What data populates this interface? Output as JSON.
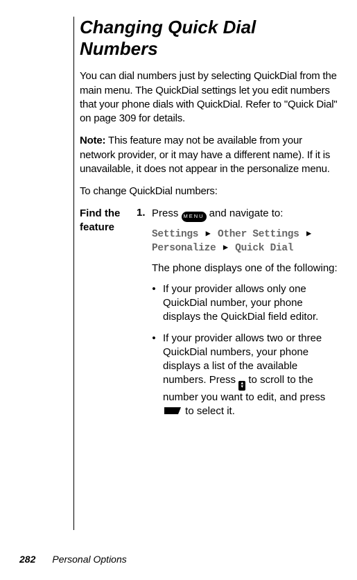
{
  "page": {
    "number": "282",
    "chapter": "Personal Options"
  },
  "heading": "Changing Quick Dial Numbers",
  "intro": "You can dial numbers just by selecting QuickDial from the main menu. The QuickDial settings let you edit numbers that your phone dials with QuickDial. Refer to \"Quick Dial\" on page 309 for details.",
  "note_label": "Note:",
  "note_body": " This feature may not be available from your network provider, or it may have a different name). If it is unavailable, it does not appear in the personalize menu.",
  "lead_in": "To change QuickDial numbers:",
  "left_label_line1": "Find the",
  "left_label_line2": "feature",
  "step1": {
    "num": "1.",
    "prefix": "Press ",
    "menu_key": "MENU",
    "suffix": " and navigate to:"
  },
  "menu_path": {
    "p1": "Settings",
    "p2": "Other Settings",
    "p3": "Personalize",
    "p4": "Quick Dial"
  },
  "after_path": "The phone displays one of the following:",
  "bullets": [
    "If your provider allows only one QuickDial number, your phone displays the QuickDial field editor.",
    {
      "pre": "If your provider allows two or three QuickDial numbers, your phone displays a list of the available numbers. Press ",
      "mid": " to scroll to the number you want to edit, and press ",
      "post": " to select it."
    }
  ]
}
